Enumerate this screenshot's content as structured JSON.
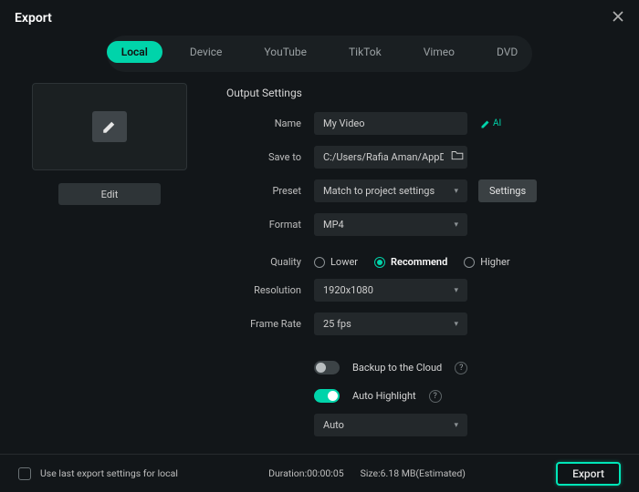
{
  "window": {
    "title": "Export"
  },
  "tabs": [
    "Local",
    "Device",
    "YouTube",
    "TikTok",
    "Vimeo",
    "DVD"
  ],
  "active_tab": 0,
  "thumbnail": {
    "edit_label": "Edit"
  },
  "settings": {
    "section_title": "Output Settings",
    "name": {
      "label": "Name",
      "value": "My Video",
      "ai_badge": "AI"
    },
    "save_to": {
      "label": "Save to",
      "value": "C:/Users/Rafia Aman/AppData"
    },
    "preset": {
      "label": "Preset",
      "value": "Match to project settings",
      "settings_btn": "Settings"
    },
    "format": {
      "label": "Format",
      "value": "MP4"
    },
    "quality": {
      "label": "Quality",
      "options": [
        "Lower",
        "Recommend",
        "Higher"
      ],
      "selected": 1
    },
    "resolution": {
      "label": "Resolution",
      "value": "1920x1080"
    },
    "frame_rate": {
      "label": "Frame Rate",
      "value": "25 fps"
    },
    "backup_cloud": {
      "label": "Backup to the Cloud",
      "on": false
    },
    "auto_highlight": {
      "label": "Auto Highlight",
      "on": true,
      "mode": "Auto"
    }
  },
  "footer": {
    "use_last_label": "Use last export settings for local",
    "use_last_checked": false,
    "duration_label": "Duration:00:00:05",
    "size_label": "Size:6.18 MB(Estimated)",
    "export_btn": "Export"
  }
}
